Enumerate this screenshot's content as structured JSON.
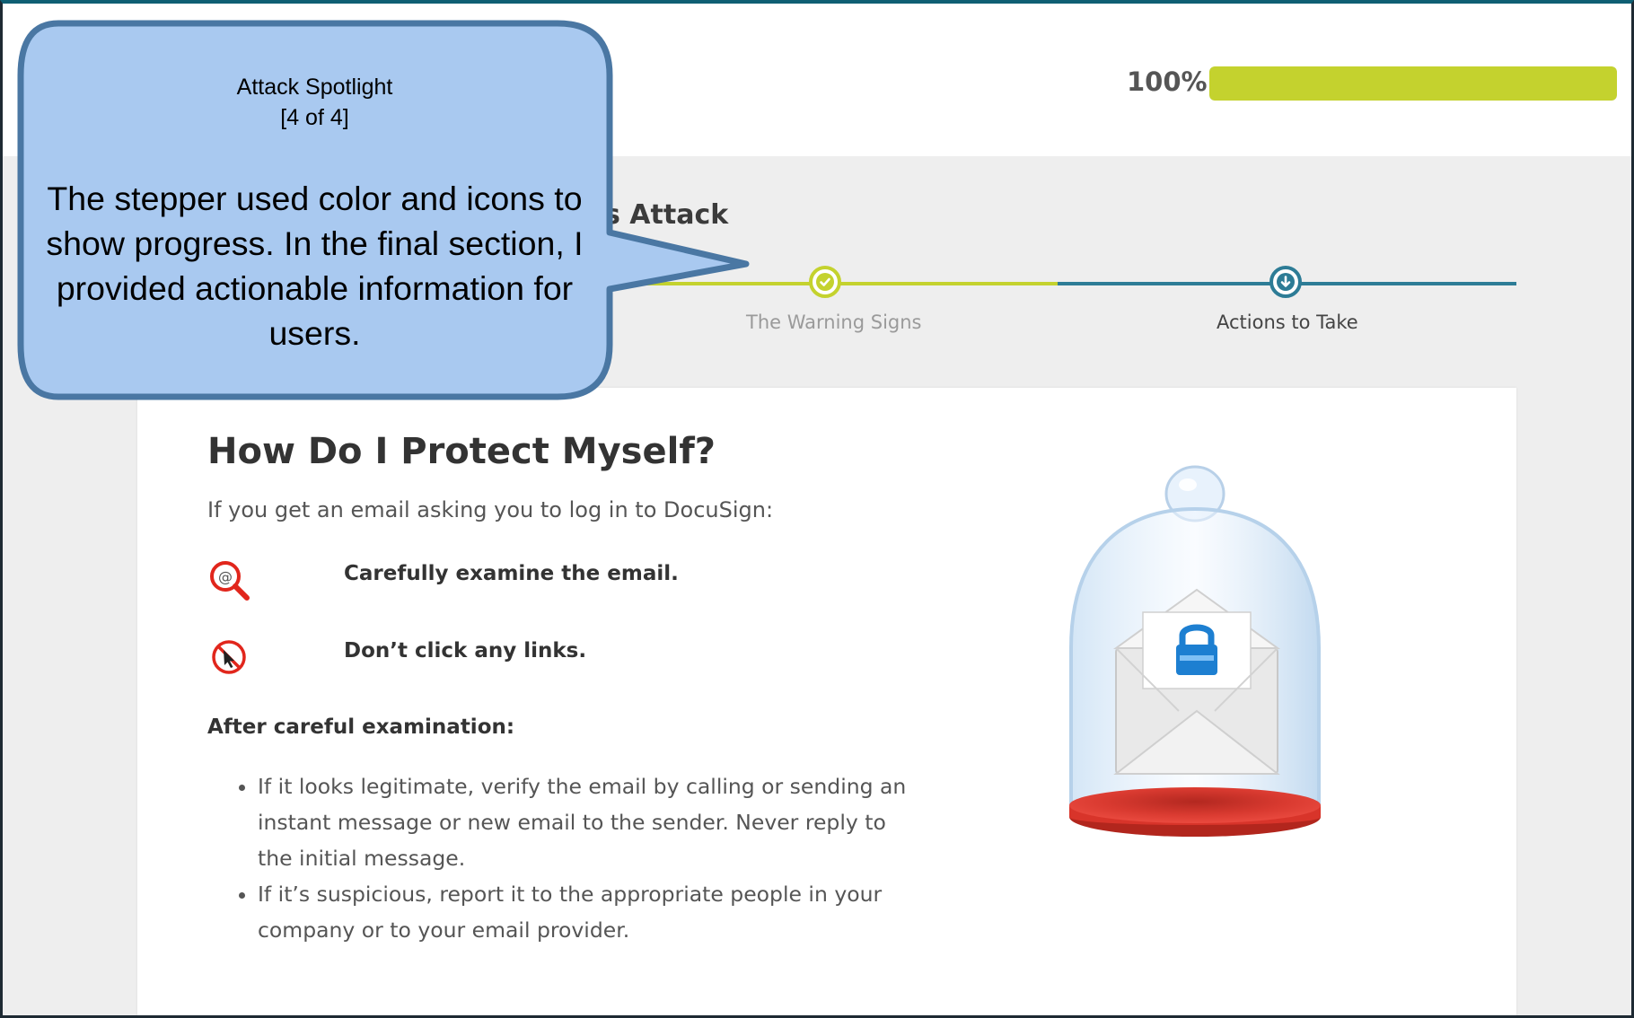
{
  "progress": {
    "percent_label": "100%",
    "value": 1.0,
    "fill_color": "#c4d22e"
  },
  "course": {
    "title_visible": "s Attack"
  },
  "stepper": {
    "steps": [
      {
        "label": "The Warning Signs",
        "state": "complete",
        "icon": "check-icon"
      },
      {
        "label": "Actions to Take",
        "state": "current",
        "icon": "arrow-down-icon"
      }
    ],
    "complete_color": "#c4d22e",
    "current_color": "#2d7c96"
  },
  "content": {
    "heading": "How Do I Protect Myself?",
    "intro": "If you get an email asking you to log in to DocuSign:",
    "tips": [
      {
        "icon": "email-magnifier-icon",
        "text": "Carefully examine the email."
      },
      {
        "icon": "no-click-icon",
        "text": "Don’t click any links."
      }
    ],
    "after_label": "After careful examination:",
    "bullets": [
      "If it looks legitimate, verify the email by calling or sending an instant message or new email to the sender. Never reply to the initial message.",
      "If it’s suspicious, report it to the appropriate people in your company or to your email provider."
    ],
    "illustration": "locked-envelope-under-glass-dome"
  },
  "callout": {
    "title": "Attack Spotlight",
    "counter": "[4 of 4]",
    "body": "The stepper used color and icons to show progress. In the final section, I provided actionable information for users.",
    "fill_color": "#a9c9f0",
    "border_color": "#4a77a3"
  }
}
